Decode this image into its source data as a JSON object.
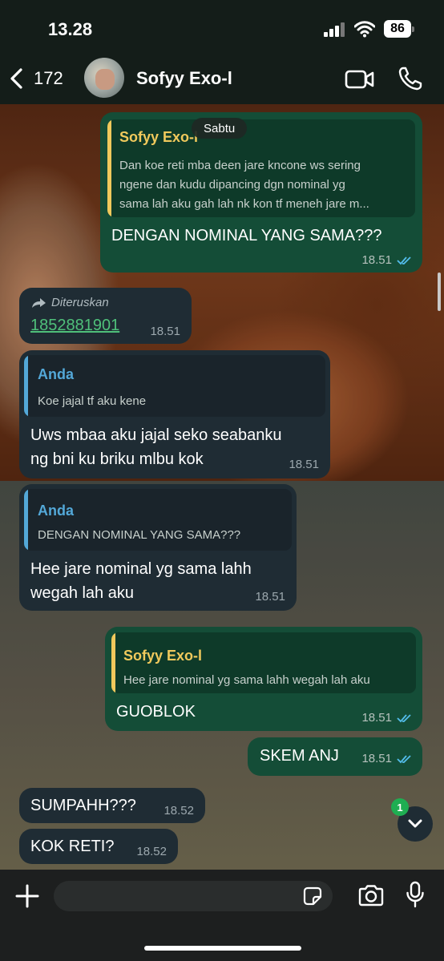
{
  "status_bar": {
    "time": "13.28",
    "battery": "86"
  },
  "header": {
    "back_count": "172",
    "contact_name": "Sofyy Exo-l"
  },
  "date_pill": "Sabtu",
  "messages": [
    {
      "direction": "out",
      "quote_author": "Sofyy Exo-l",
      "quote_lines": [
        "Dan koe reti mba deen jare kncone ws sering",
        "ngene dan kudu dipancing dgn nominal yg",
        "sama lah aku gah lah nk kon tf meneh jare m..."
      ],
      "text": "DENGAN NOMINAL YANG SAMA???",
      "time": "18.51"
    },
    {
      "direction": "in",
      "forwarded_label": "Diteruskan",
      "text": "1852881901",
      "time": "18.51"
    },
    {
      "direction": "in",
      "quote_author": "Anda",
      "quote_lines": [
        "Koe jajal tf aku kene"
      ],
      "text_lines": [
        "Uws mbaa aku jajal seko seabanku",
        "ng bni ku briku mlbu kok"
      ],
      "time": "18.51"
    },
    {
      "direction": "in",
      "quote_author": "Anda",
      "quote_lines": [
        "DENGAN NOMINAL YANG SAMA???"
      ],
      "text_lines": [
        "Hee jare nominal yg sama lahh",
        "wegah lah aku"
      ],
      "time": "18.51"
    },
    {
      "direction": "out",
      "quote_author": "Sofyy Exo-l",
      "quote_lines": [
        "Hee jare nominal yg sama lahh wegah lah aku"
      ],
      "text": "GUOBLOK",
      "time": "18.51"
    },
    {
      "direction": "out",
      "text": "SKEM ANJ",
      "time": "18.51"
    },
    {
      "direction": "in",
      "text": "SUMPAHH???",
      "time": "18.52"
    },
    {
      "direction": "in",
      "text": "KOK RETI?",
      "time": "18.52"
    }
  ],
  "unread_count": "1",
  "input": {
    "value": "",
    "placeholder": ""
  },
  "colors": {
    "outgoing_bubble": "#144d37",
    "incoming_bubble": "#1f2c34",
    "quote_author_out": "#f0c95c",
    "quote_author_in": "#53a8d8",
    "read_ticks": "#53bdeb",
    "link": "#4fc07a"
  }
}
